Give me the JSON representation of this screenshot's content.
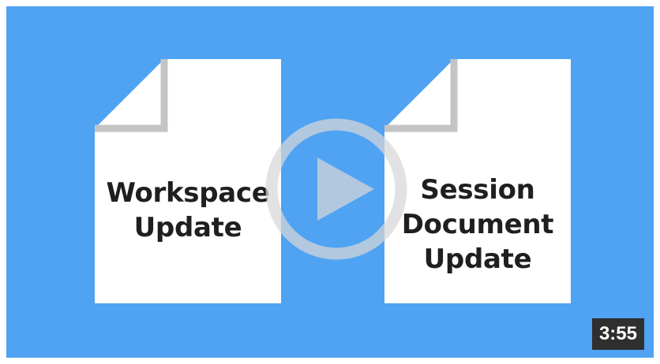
{
  "video": {
    "documents": [
      {
        "lines": [
          "Workspace",
          "Update"
        ]
      },
      {
        "lines": [
          "Session",
          "Document",
          "Update"
        ]
      }
    ],
    "duration": "3:55",
    "colors": {
      "background": "#4fa3f2",
      "document": "#ffffff",
      "fold": "#c4c4c4",
      "play_icon": "#d7d7d7",
      "duration_bg": "#2f2f2f"
    },
    "play_icon": "play-icon"
  }
}
